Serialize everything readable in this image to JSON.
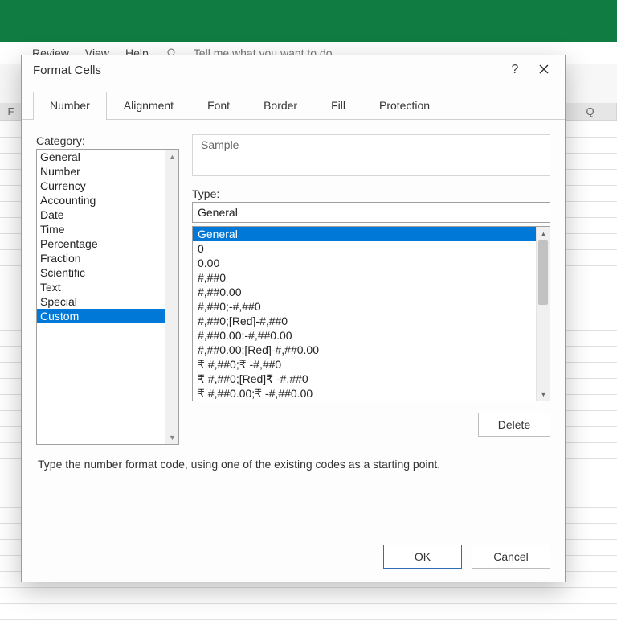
{
  "excel": {
    "menu_items": [
      "Review",
      "View",
      "Help"
    ],
    "tell_me": "Tell me what you want to do",
    "col_labels_left": [
      "F"
    ],
    "col_labels_right": [
      "Q"
    ]
  },
  "dialog": {
    "title": "Format Cells",
    "help_symbol": "?",
    "tabs": [
      "Number",
      "Alignment",
      "Font",
      "Border",
      "Fill",
      "Protection"
    ],
    "active_tab": "Number",
    "category_label": "Category:",
    "category_underline": "C",
    "categories": [
      "General",
      "Number",
      "Currency",
      "Accounting",
      "Date",
      "Time",
      "Percentage",
      "Fraction",
      "Scientific",
      "Text",
      "Special",
      "Custom"
    ],
    "selected_category": "Custom",
    "sample_label": "Sample",
    "type_label": "Type:",
    "type_underline": "T",
    "type_value": "General",
    "type_list": [
      "General",
      "0",
      "0.00",
      "#,##0",
      "#,##0.00",
      "#,##0;-#,##0",
      "#,##0;[Red]-#,##0",
      "#,##0.00;-#,##0.00",
      "#,##0.00;[Red]-#,##0.00",
      "₹ #,##0;₹ -#,##0",
      "₹ #,##0;[Red]₹ -#,##0",
      "₹ #,##0.00;₹ -#,##0.00"
    ],
    "selected_type_index": 0,
    "delete_label": "Delete",
    "description": "Type the number format code, using one of the existing codes as a starting point.",
    "ok_label": "OK",
    "cancel_label": "Cancel"
  }
}
